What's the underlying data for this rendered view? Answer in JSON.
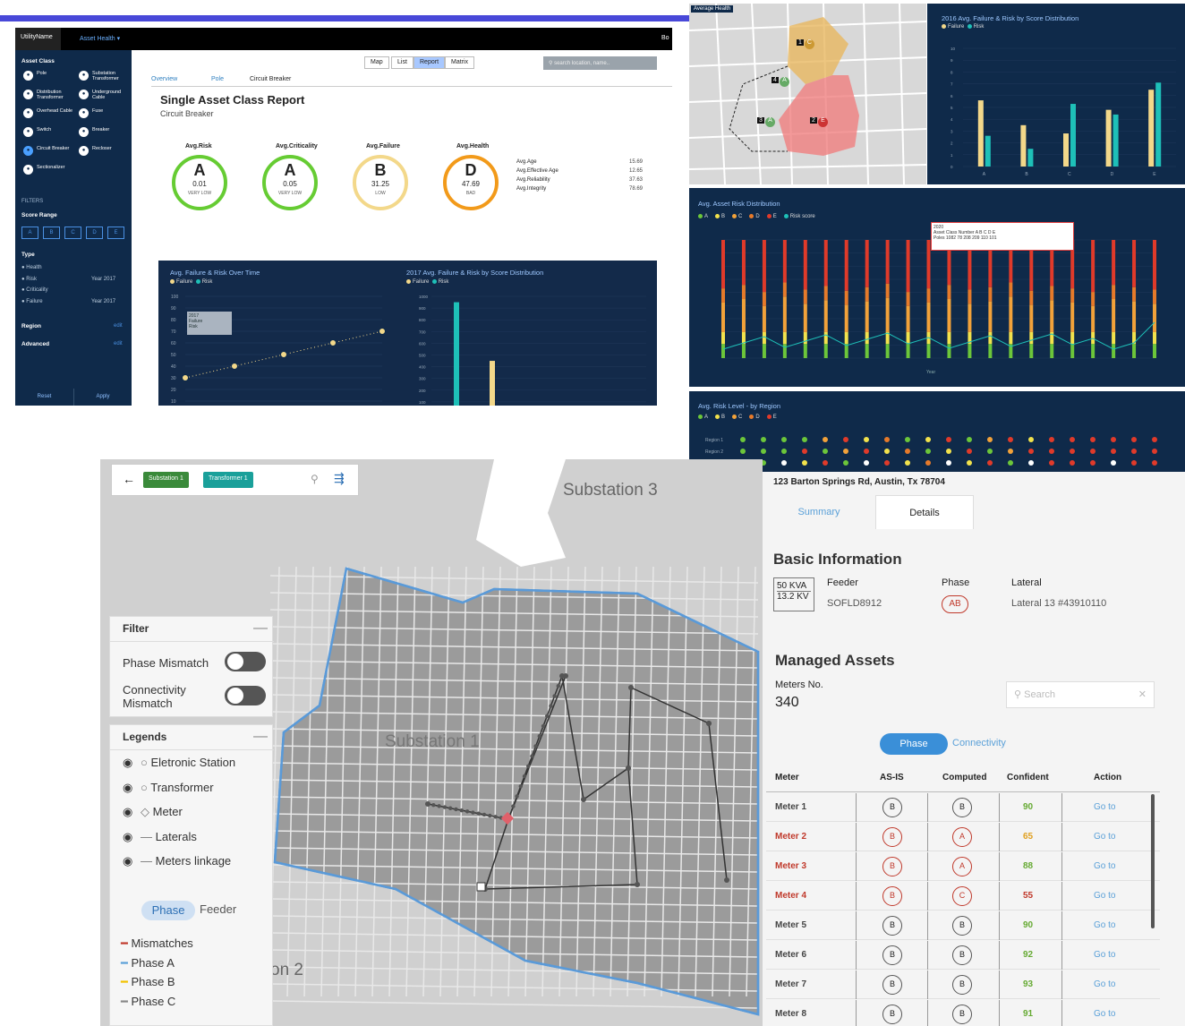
{
  "report": {
    "nav": {
      "utility": "UtilityName",
      "dropdown": "Asset Health",
      "right": "Bo"
    },
    "sidebar": {
      "asset_class_title": "Asset Class",
      "items": [
        {
          "label": "Pole"
        },
        {
          "label": "Substation Transformer"
        },
        {
          "label": "Distribution Transformer"
        },
        {
          "label": "Underground Cable"
        },
        {
          "label": "Overhead Cable"
        },
        {
          "label": "Fuse"
        },
        {
          "label": "Switch"
        },
        {
          "label": "Breaker"
        },
        {
          "label": "Circuit Breaker"
        },
        {
          "label": "Recloser"
        },
        {
          "label": "Sectionalizer"
        }
      ],
      "filters_title": "FILTERS",
      "score_range": "Score Range",
      "grades": [
        "A",
        "B",
        "C",
        "D",
        "E"
      ],
      "type_title": "Type",
      "types": [
        {
          "label": "Health",
          "date": ""
        },
        {
          "label": "Risk",
          "date": "Year 2017"
        },
        {
          "label": "Criticality",
          "date": ""
        },
        {
          "label": "Failure",
          "date": "Year 2017"
        }
      ],
      "region": "Region",
      "advanced": "Advanced",
      "edit": "edit",
      "reset": "Reset",
      "apply": "Apply"
    },
    "view_tabs": [
      "Map",
      "List",
      "Report",
      "Matrix"
    ],
    "search_placeholder": "search location, name..",
    "sub_tabs": [
      "Overview",
      "Pole",
      "Circuit Breaker"
    ],
    "title": "Single Asset Class Report",
    "subtitle": "Circuit Breaker",
    "gauges": [
      {
        "label": "Avg.Risk",
        "grade": "A",
        "value": "0.01",
        "status": "VERY LOW",
        "color": "#66cc33"
      },
      {
        "label": "Avg.Criticality",
        "grade": "A",
        "value": "0.05",
        "status": "VERY LOW",
        "color": "#66cc33"
      },
      {
        "label": "Avg.Failure",
        "grade": "B",
        "value": "31.25",
        "status": "LOW",
        "color": "#f3d88a"
      },
      {
        "label": "Avg.Health",
        "grade": "D",
        "value": "47.69",
        "status": "BAD",
        "color": "#f29a1a"
      }
    ],
    "stats": [
      {
        "k": "Avg.Age",
        "v": "15.69"
      },
      {
        "k": "Avg.Effective Age",
        "v": "12.65"
      },
      {
        "k": "Avg.Reliability",
        "v": "37.63"
      },
      {
        "k": "Avg.Integrity",
        "v": "78.69"
      }
    ],
    "chart1_title": "Avg. Failure & Risk Over Time",
    "chart2_title": "2017 Avg. Failure & Risk by Score Distribution",
    "legend": [
      "Failure",
      "Risk"
    ],
    "tooltip": {
      "year": "2017",
      "failure": "Failure",
      "risk": "Risk"
    }
  },
  "top_right": {
    "map_label": "Average Health",
    "map_markers": [
      {
        "id": "1",
        "g": "C"
      },
      {
        "id": "4",
        "g": "A"
      },
      {
        "id": "3",
        "g": "A"
      },
      {
        "id": "2",
        "g": "E"
      }
    ],
    "ch2_title": "2016 Avg. Failure & Risk by Score Distribution",
    "ch3_title": "Avg. Asset Risk Distribution",
    "ch3_legend": [
      "A",
      "B",
      "C",
      "D",
      "E",
      "Risk score"
    ],
    "ch3_xlabel": "Year",
    "ch3_tip": {
      "year": "2020",
      "c1": "Asset Class",
      "c2": "Number",
      "v1": "Poles",
      "v2": "1082",
      "grades": [
        "A",
        "B",
        "C",
        "D",
        "E"
      ],
      "vals": [
        "78",
        "208",
        "209",
        "110",
        "101"
      ]
    },
    "ch4_title": "Avg. Risk Level - by Region",
    "ch4_legend": [
      "A",
      "B",
      "C",
      "D",
      "E"
    ],
    "ch4_rows": [
      "Region 1",
      "Region 2",
      "Region 3"
    ]
  },
  "network_map": {
    "chips": [
      "Substation 1",
      "Transformer 1"
    ],
    "substation3": "Substation 3",
    "substation1": "Substation 1",
    "substation2": "on 2",
    "filter": {
      "title": "Filter",
      "items": [
        "Phase Mismatch",
        "Connectivity Mismatch"
      ]
    },
    "legends": {
      "title": "Legends",
      "items": [
        "Eletronic Station",
        "Transformer",
        "Meter",
        "Laterals",
        "Meters linkage"
      ],
      "tabs": [
        "Phase",
        "Feeder"
      ],
      "lines": [
        {
          "label": "Mismatches",
          "color": "#c0392b"
        },
        {
          "label": "Phase A",
          "color": "#5aa0d8"
        },
        {
          "label": "Phase B",
          "color": "#f2c200"
        },
        {
          "label": "Phase C",
          "color": "#888888"
        }
      ]
    }
  },
  "detail": {
    "address": "123 Barton Springs Rd, Austin, Tx 78704",
    "tabs": [
      "Summary",
      "Details"
    ],
    "basic_title": "Basic Information",
    "kva": "50 KVA",
    "kv": "13.2 KV",
    "feeder_label": "Feeder",
    "feeder": "SOFLD8912",
    "phase_label": "Phase",
    "phase": "AB",
    "lateral_label": "Lateral",
    "lateral": "Lateral 13 #43910110",
    "managed_title": "Managed Assets",
    "meters_label": "Meters No.",
    "meters": "340",
    "search_placeholder": "Search",
    "toggle": [
      "Phase",
      "Connectivity"
    ],
    "headers": [
      "Meter",
      "AS-IS",
      "Computed",
      "Confident",
      "Action"
    ],
    "rows": [
      {
        "meter": "Meter 1",
        "asis": "B",
        "computed": "B",
        "conf": "90",
        "action": "Go to",
        "bad": false,
        "cc": "#66aa33"
      },
      {
        "meter": "Meter 2",
        "asis": "B",
        "computed": "A",
        "conf": "65",
        "action": "Go to",
        "bad": true,
        "cc": "#e0a020"
      },
      {
        "meter": "Meter 3",
        "asis": "B",
        "computed": "A",
        "conf": "88",
        "action": "Go to",
        "bad": true,
        "cc": "#66aa33"
      },
      {
        "meter": "Meter 4",
        "asis": "B",
        "computed": "C",
        "conf": "55",
        "action": "Go to",
        "bad": true,
        "cc": "#c0392b"
      },
      {
        "meter": "Meter 5",
        "asis": "B",
        "computed": "B",
        "conf": "90",
        "action": "Go to",
        "bad": false,
        "cc": "#66aa33"
      },
      {
        "meter": "Meter 6",
        "asis": "B",
        "computed": "B",
        "conf": "92",
        "action": "Go to",
        "bad": false,
        "cc": "#66aa33"
      },
      {
        "meter": "Meter 7",
        "asis": "B",
        "computed": "B",
        "conf": "93",
        "action": "Go to",
        "bad": false,
        "cc": "#66aa33"
      },
      {
        "meter": "Meter 8",
        "asis": "B",
        "computed": "B",
        "conf": "91",
        "action": "Go to",
        "bad": false,
        "cc": "#66aa33"
      }
    ]
  },
  "chart_data": [
    {
      "type": "line",
      "title": "Avg. Failure & Risk Over Time",
      "x": [
        "2017",
        "2021",
        "2025",
        "2029",
        "2033"
      ],
      "series": [
        {
          "name": "Failure",
          "values": [
            30,
            40,
            50,
            60,
            70
          ]
        },
        {
          "name": "Risk",
          "values": [
            0,
            0,
            0,
            0,
            0
          ]
        }
      ],
      "ylim": [
        0,
        100
      ]
    },
    {
      "type": "bar",
      "title": "2017 Avg. Failure & Risk by Score Distribution",
      "categories": [
        "A",
        "B",
        "C",
        "D",
        "E"
      ],
      "series": [
        {
          "name": "Failure",
          "values": [
            0,
            450,
            0,
            0,
            60
          ]
        },
        {
          "name": "Risk",
          "values": [
            950,
            0,
            0,
            0,
            0
          ]
        }
      ],
      "ylim": [
        0,
        1000
      ]
    },
    {
      "type": "bar",
      "title": "2016 Avg. Failure & Risk by Score Distribution",
      "categories": [
        "A",
        "B",
        "C",
        "D",
        "E"
      ],
      "series": [
        {
          "name": "Failure",
          "values": [
            5.6,
            3.5,
            2.8,
            4.8,
            6.5
          ]
        },
        {
          "name": "Risk",
          "values": [
            2.6,
            1.5,
            5.3,
            4.4,
            7.1
          ]
        }
      ],
      "ylim": [
        0,
        10
      ]
    }
  ]
}
